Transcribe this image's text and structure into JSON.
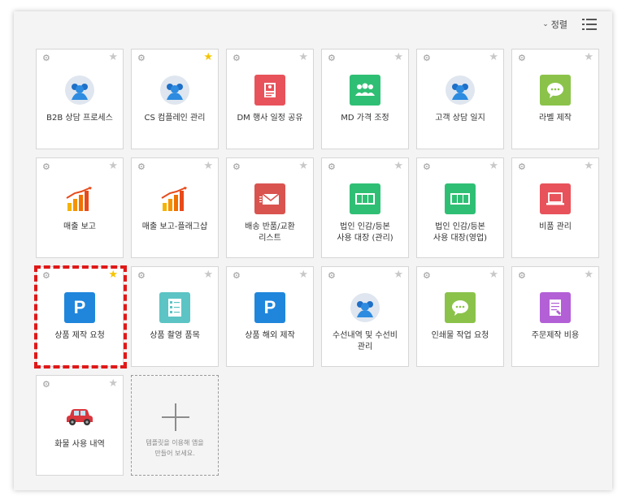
{
  "toolbar": {
    "sort_label": "정렬",
    "sort_icon": "chevron-down-icon",
    "view_icon": "list-view-icon"
  },
  "colors": {
    "star_on": "#f5c400",
    "star_off": "#c8c8c8",
    "highlight": "#e01818"
  },
  "cards": [
    {
      "label": "B2B 상담 프로세스",
      "icon": "people-icon",
      "starred": false
    },
    {
      "label": "CS 컴플레인 관리",
      "icon": "people-icon",
      "starred": true
    },
    {
      "label": "DM 행사 일정 공유",
      "icon": "document-icon",
      "starred": false
    },
    {
      "label": "MD 가격 조정",
      "icon": "team-icon",
      "starred": false
    },
    {
      "label": "고객 상담 일지",
      "icon": "people-icon",
      "starred": false
    },
    {
      "label": "라벨 제작",
      "icon": "chat-bubble-icon",
      "starred": false
    },
    {
      "label": "매출 보고",
      "icon": "bar-chart-icon",
      "starred": false
    },
    {
      "label": "매출 보고-플래그샵",
      "icon": "bar-chart-icon",
      "starred": false
    },
    {
      "label": "배송 반품/교환\n리스트",
      "icon": "mail-icon",
      "starred": false
    },
    {
      "label": "법인 인감/등본\n사용 대장 (관리)",
      "icon": "stamp-icon",
      "starred": false
    },
    {
      "label": "법인 인감/등본\n사용 대장(영업)",
      "icon": "stamp-icon",
      "starred": false
    },
    {
      "label": "비품 관리",
      "icon": "laptop-icon",
      "starred": false
    },
    {
      "label": "상품 제작 요청",
      "icon": "p-icon",
      "starred": true
    },
    {
      "label": "상품 촬영 품목",
      "icon": "checklist-icon",
      "starred": false
    },
    {
      "label": "상품 해외 제작",
      "icon": "p-icon",
      "starred": false
    },
    {
      "label": "수선내역 및 수선비\n관리",
      "icon": "people-icon",
      "starred": false
    },
    {
      "label": "인쇄물 작업 요청",
      "icon": "chat-bubble-icon",
      "starred": false
    },
    {
      "label": "주문제작 비용",
      "icon": "order-form-icon",
      "starred": false
    },
    {
      "label": "화물 사용 내역",
      "icon": "car-icon",
      "starred": false
    }
  ],
  "add_card": {
    "hint": "템플릿을 이용해 앱을\n만들어 보세요.",
    "icon": "plus-icon"
  }
}
